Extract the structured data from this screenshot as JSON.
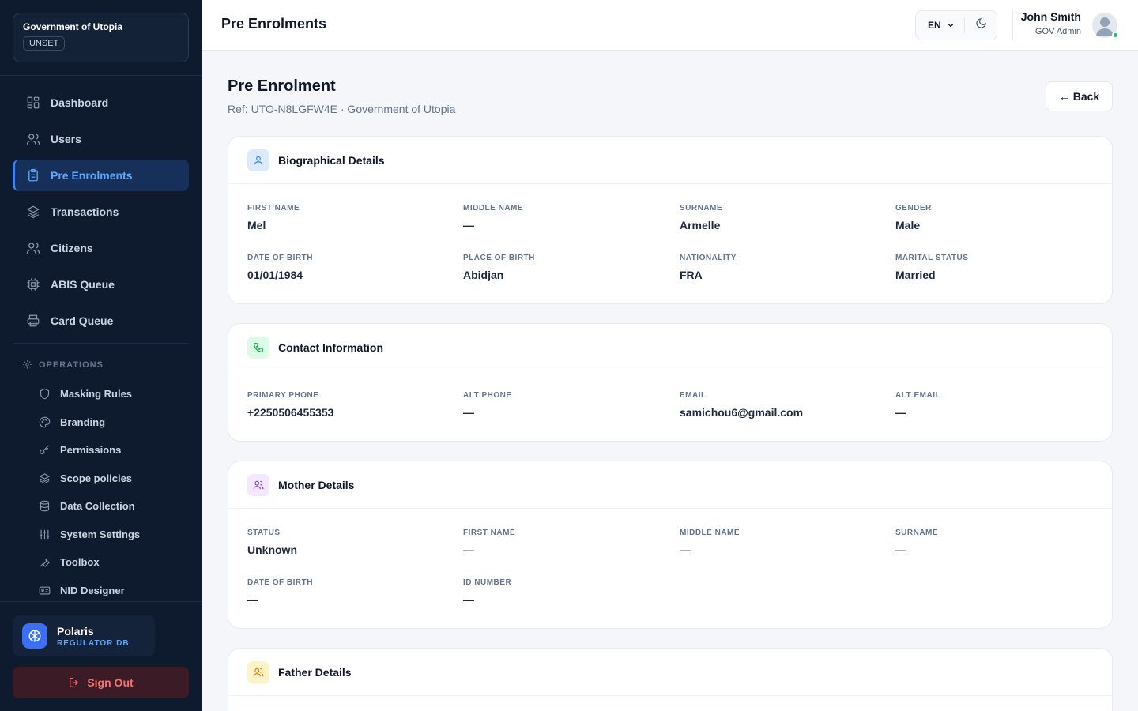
{
  "sidebar": {
    "org_name": "Government of Utopia",
    "org_badge": "UNSET",
    "nav": [
      {
        "label": "Dashboard",
        "icon": "dashboard-icon"
      },
      {
        "label": "Users",
        "icon": "users-icon"
      },
      {
        "label": "Pre Enrolments",
        "icon": "clipboard-icon",
        "active": true
      },
      {
        "label": "Transactions",
        "icon": "layers-icon"
      },
      {
        "label": "Citizens",
        "icon": "citizens-icon"
      },
      {
        "label": "ABIS Queue",
        "icon": "cpu-icon"
      },
      {
        "label": "Card Queue",
        "icon": "printer-icon"
      }
    ],
    "operations_heading": "OPERATIONS",
    "operations": [
      {
        "label": "Masking Rules",
        "icon": "shield-icon"
      },
      {
        "label": "Branding",
        "icon": "palette-icon"
      },
      {
        "label": "Permissions",
        "icon": "key-icon"
      },
      {
        "label": "Scope policies",
        "icon": "layers-icon"
      },
      {
        "label": "Data Collection",
        "icon": "database-icon"
      },
      {
        "label": "System Settings",
        "icon": "sliders-icon"
      },
      {
        "label": "Toolbox",
        "icon": "wrench-icon"
      },
      {
        "label": "NID Designer",
        "icon": "id-card-icon"
      }
    ],
    "brand_name": "Polaris",
    "brand_sub": "REGULATOR DB",
    "sign_out": "Sign Out"
  },
  "header": {
    "title": "Pre Enrolments",
    "language": "EN",
    "user_name": "John Smith",
    "user_role": "GOV Admin"
  },
  "page": {
    "title": "Pre Enrolment",
    "subtitle": "Ref: UTO-N8LGFW4E · Government of Utopia",
    "back_label": "← Back"
  },
  "sections": {
    "bio": {
      "title": "Biographical Details",
      "fields": [
        {
          "label": "FIRST NAME",
          "value": "Mel"
        },
        {
          "label": "MIDDLE NAME",
          "value": "—"
        },
        {
          "label": "SURNAME",
          "value": "Armelle"
        },
        {
          "label": "GENDER",
          "value": "Male"
        },
        {
          "label": "DATE OF BIRTH",
          "value": "01/01/1984"
        },
        {
          "label": "PLACE OF BIRTH",
          "value": "Abidjan"
        },
        {
          "label": "NATIONALITY",
          "value": "FRA"
        },
        {
          "label": "MARITAL STATUS",
          "value": "Married"
        }
      ]
    },
    "contact": {
      "title": "Contact Information",
      "fields": [
        {
          "label": "PRIMARY PHONE",
          "value": "+2250506455353"
        },
        {
          "label": "ALT PHONE",
          "value": "—"
        },
        {
          "label": "EMAIL",
          "value": "samichou6@gmail.com"
        },
        {
          "label": "ALT EMAIL",
          "value": "—"
        }
      ]
    },
    "mother": {
      "title": "Mother Details",
      "fields": [
        {
          "label": "STATUS",
          "value": "Unknown"
        },
        {
          "label": "FIRST NAME",
          "value": "—"
        },
        {
          "label": "MIDDLE NAME",
          "value": "—"
        },
        {
          "label": "SURNAME",
          "value": "—"
        },
        {
          "label": "DATE OF BIRTH",
          "value": "—"
        },
        {
          "label": "ID NUMBER",
          "value": "—"
        }
      ]
    },
    "father": {
      "title": "Father Details"
    }
  },
  "colors": {
    "sidebar_bg": "#0e1a2e",
    "accent": "#3b82f6",
    "danger": "#f87171",
    "online": "#22c55e"
  }
}
